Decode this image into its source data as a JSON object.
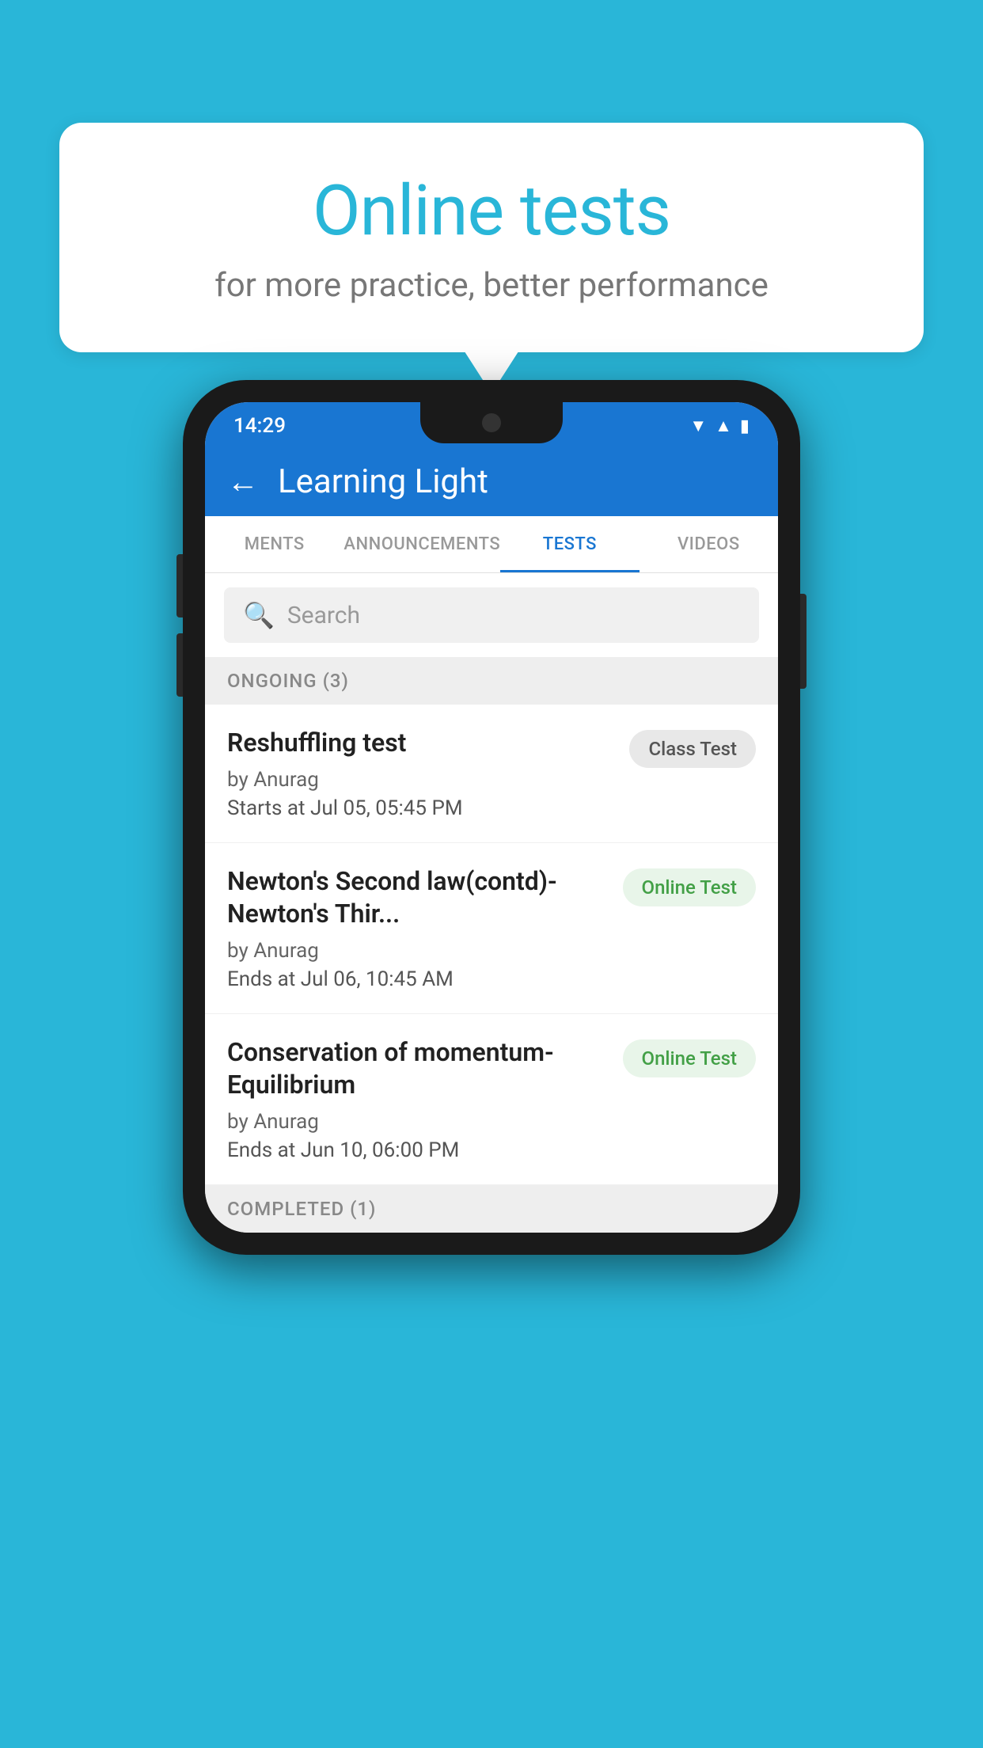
{
  "background": {
    "color": "#29b6d8"
  },
  "speech_bubble": {
    "title": "Online tests",
    "subtitle": "for more practice, better performance"
  },
  "phone": {
    "status_bar": {
      "time": "14:29",
      "icons": [
        "wifi",
        "signal",
        "battery"
      ]
    },
    "app_header": {
      "title": "Learning Light",
      "back_label": "←"
    },
    "tabs": [
      {
        "label": "MENTS",
        "active": false
      },
      {
        "label": "ANNOUNCEMENTS",
        "active": false
      },
      {
        "label": "TESTS",
        "active": true
      },
      {
        "label": "VIDEOS",
        "active": false
      }
    ],
    "search": {
      "placeholder": "Search"
    },
    "ongoing_section": {
      "title": "ONGOING (3)"
    },
    "test_items": [
      {
        "name": "Reshuffling test",
        "author": "by Anurag",
        "time_label": "Starts at",
        "time": "Jul 05, 05:45 PM",
        "badge": "Class Test",
        "badge_type": "class"
      },
      {
        "name": "Newton's Second law(contd)-Newton's Thir...",
        "author": "by Anurag",
        "time_label": "Ends at",
        "time": "Jul 06, 10:45 AM",
        "badge": "Online Test",
        "badge_type": "online"
      },
      {
        "name": "Conservation of momentum-Equilibrium",
        "author": "by Anurag",
        "time_label": "Ends at",
        "time": "Jun 10, 06:00 PM",
        "badge": "Online Test",
        "badge_type": "online"
      }
    ],
    "completed_section": {
      "title": "COMPLETED (1)"
    }
  }
}
